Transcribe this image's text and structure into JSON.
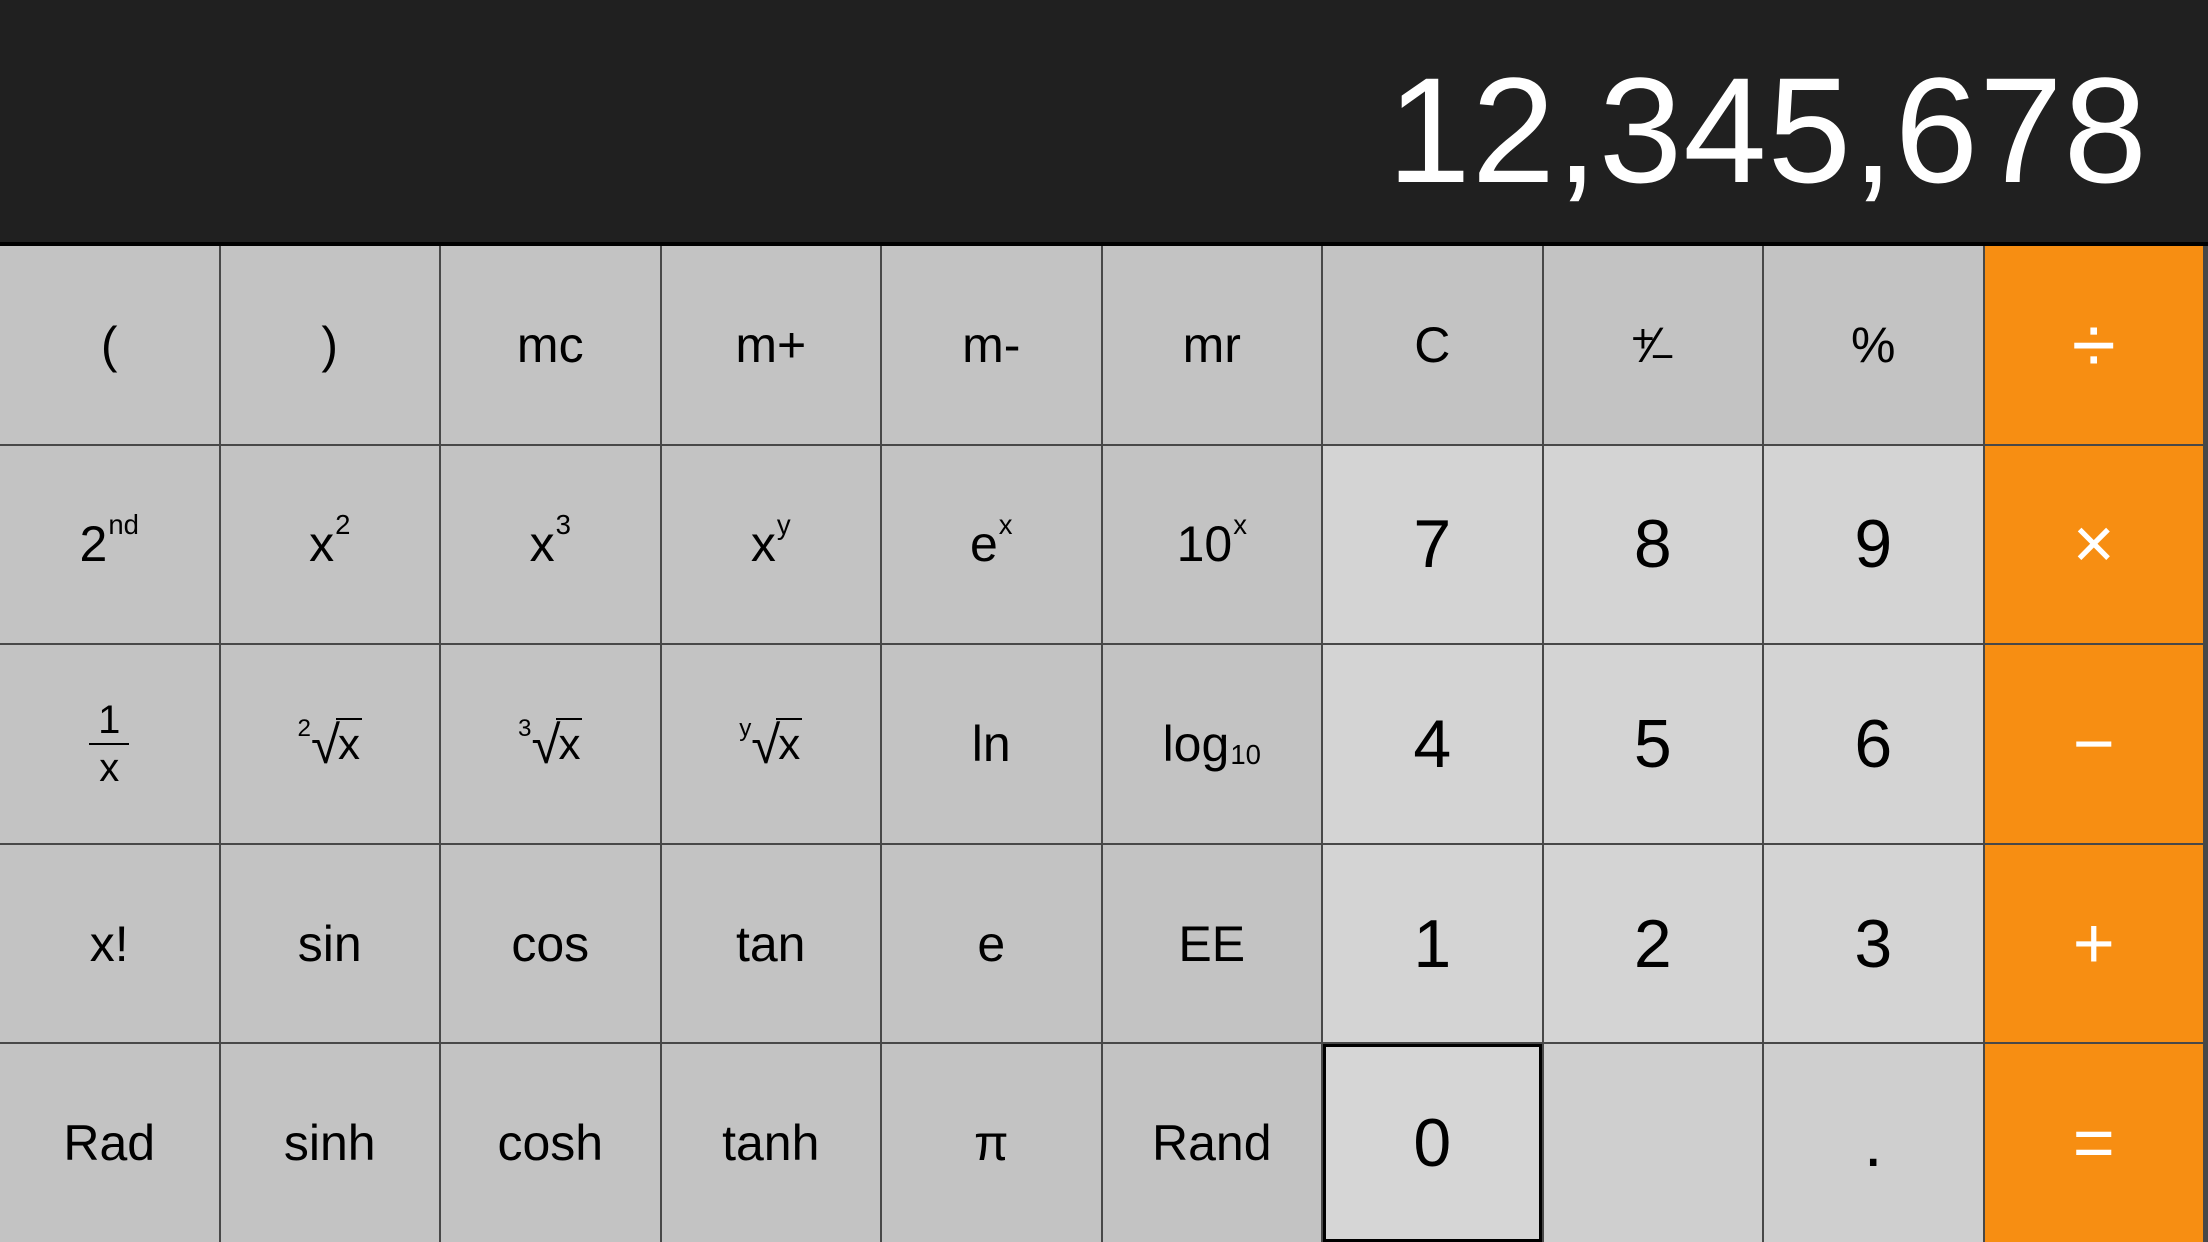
{
  "display": "12,345,678",
  "keys": {
    "lparen": "(",
    "rparen": ")",
    "mc": "mc",
    "mplus": "m+",
    "mminus": "m-",
    "mr": "mr",
    "clear": "C",
    "percent": "%",
    "divide": "÷",
    "second_base": "2",
    "second_sup": "nd",
    "xsq_base": "x",
    "xsq_sup": "2",
    "xcb_base": "x",
    "xcb_sup": "3",
    "xy_base": "x",
    "xy_sup": "y",
    "ex_base": "e",
    "ex_sup": "x",
    "tenx_base": "10",
    "tenx_sup": "x",
    "seven": "7",
    "eight": "8",
    "nine": "9",
    "multiply": "×",
    "recip_top": "1",
    "recip_bot": "x",
    "sqrt_pre": "2",
    "sqrt_x": "x",
    "cbrt_pre": "3",
    "cbrt_x": "x",
    "yroot_pre": "y",
    "yroot_x": "x",
    "ln": "ln",
    "log_base": "log",
    "log_sub": "10",
    "four": "4",
    "five": "5",
    "six": "6",
    "minus": "−",
    "factorial": "x!",
    "sin": "sin",
    "cos": "cos",
    "tan": "tan",
    "e": "e",
    "ee": "EE",
    "one": "1",
    "two": "2",
    "three": "3",
    "plus": "+",
    "rad": "Rad",
    "sinh": "sinh",
    "cosh": "cosh",
    "tanh": "tanh",
    "pi": "π",
    "rand": "Rand",
    "zero": "0",
    "decimal": ".",
    "equals": "=",
    "pm_plus": "+",
    "pm_minus": "−"
  }
}
